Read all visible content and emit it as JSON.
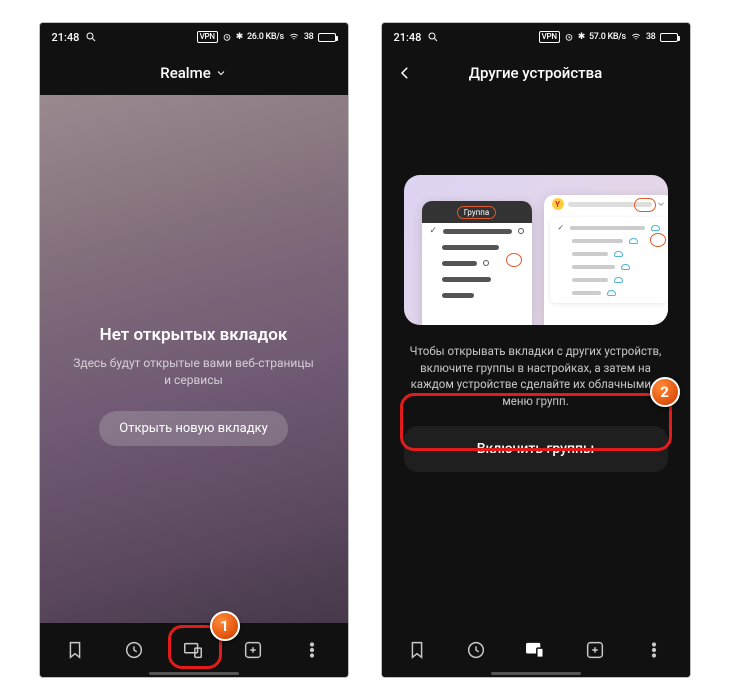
{
  "status": {
    "time": "21:48",
    "vpn": "VPN",
    "net": "26.0 KB/s",
    "net2": "57.0 KB/s",
    "signal": "38",
    "battery": "□"
  },
  "screen1": {
    "header_title": "Realme",
    "empty_title": "Нет открытых вкладок",
    "empty_sub": "Здесь будут открытые вами веб-страницы и сервисы",
    "open_btn": "Открыть новую вкладку"
  },
  "screen2": {
    "header_title": "Другие устройства",
    "illus_pill": "Группа",
    "help_text": "Чтобы открывать вкладки с других устройств, включите группы в настройках, а затем на каждом устройстве сделайте их облачными в меню групп.",
    "enable_btn": "Включить группы"
  },
  "badges": {
    "one": "1",
    "two": "2"
  }
}
